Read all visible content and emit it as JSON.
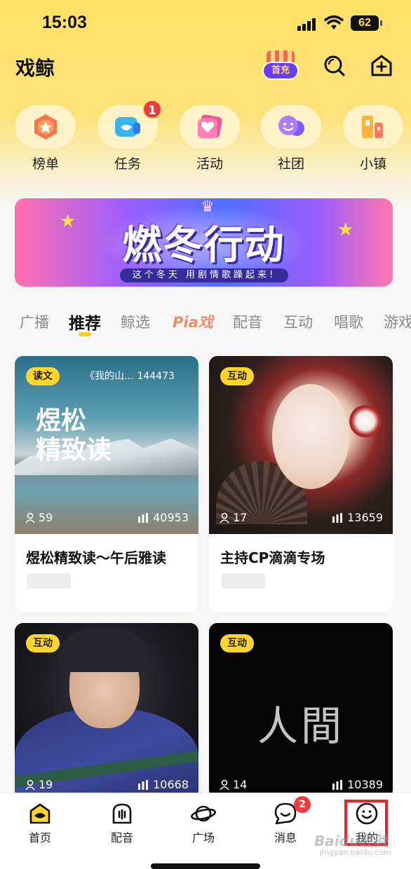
{
  "status_bar": {
    "time": "15:03",
    "battery": "62"
  },
  "header": {
    "title": "戏鲸",
    "first_charge": "首充"
  },
  "quick_entries": [
    {
      "label": "榜单",
      "icon": "ranking-icon"
    },
    {
      "label": "任务",
      "icon": "task-icon",
      "badge": "1"
    },
    {
      "label": "活动",
      "icon": "event-icon"
    },
    {
      "label": "社团",
      "icon": "club-icon"
    },
    {
      "label": "小镇",
      "icon": "town-icon"
    }
  ],
  "banner": {
    "title": "燃冬行动",
    "subtitle": "这个冬天 用剧情歌躁起来!"
  },
  "tabs": [
    "广播",
    "推荐",
    "鲸选",
    "Pia戏",
    "配音",
    "互动",
    "唱歌",
    "游戏"
  ],
  "active_tab": "推荐",
  "cards": [
    {
      "tag": "读文",
      "ticker": "《我的山…  144473",
      "cover_text": "煜松\n精致读",
      "members": "59",
      "heat": "40953",
      "title": "煜松精致读～午后雅读"
    },
    {
      "tag": "互动",
      "ticker": "",
      "members": "17",
      "heat": "13659",
      "title": "主持CP滴滴专场"
    },
    {
      "tag": "互动",
      "ticker": "",
      "members": "19",
      "heat": "10668",
      "title": ""
    },
    {
      "tag": "互动",
      "ticker": "",
      "cover_text": "人間",
      "members": "14",
      "heat": "10389",
      "title": ""
    }
  ],
  "bottom_nav": [
    {
      "label": "首页",
      "icon": "home-icon"
    },
    {
      "label": "配音",
      "icon": "dubbing-icon"
    },
    {
      "label": "广场",
      "icon": "planet-icon"
    },
    {
      "label": "消息",
      "icon": "message-icon",
      "badge": "2"
    },
    {
      "label": "我的",
      "icon": "profile-icon"
    }
  ],
  "watermark": {
    "text": "Baidu经验",
    "sub": "jingyan.baidu.com"
  },
  "colors": {
    "accent": "#ffd52e",
    "badge": "#ee3b3b",
    "highlight": "#e8232d"
  }
}
